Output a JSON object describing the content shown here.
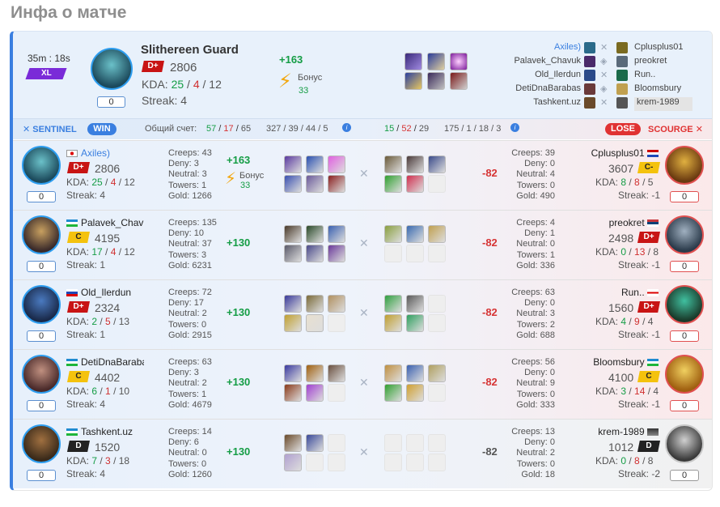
{
  "page_title": "Инфа о матче",
  "summary": {
    "duration": "35m : 18s",
    "mode": "XL",
    "player_name": "Slithereen Guard",
    "rank": "D+",
    "rating": "2806",
    "kda_label": "KDA:",
    "kills": "25",
    "deaths": "4",
    "assists": "12",
    "streak_text": "Streak: 4",
    "level": "0",
    "delta": "+163",
    "bonus_label": "Бонус",
    "bonus_value": "33"
  },
  "roster_left": [
    "Axiles)",
    "Palavek_Chavuk",
    "Old_Ilerdun",
    "DetiDnaBarabas",
    "Tashkent.uz"
  ],
  "roster_right": [
    "Cplusplus01",
    "preokret",
    "Run..",
    "Bloomsbury",
    "krem-1989"
  ],
  "scorebar": {
    "sentinel_label": "SENTINEL",
    "win_label": "WIN",
    "score_label": "Общий счет:",
    "left_kills": "57",
    "left_deaths": "17",
    "left_assists": "65",
    "left_creeps": "327 / 39 / 44 / 5",
    "right_kills": "15",
    "right_deaths": "52",
    "right_assists": "29",
    "right_creeps": "175 / 1 / 18 / 3",
    "lose_label": "LOSE",
    "scourge_label": "SCOURGE"
  },
  "rows": [
    {
      "left": {
        "name": "Axiles)",
        "rank": "D+",
        "rating": "2806",
        "k": "25",
        "d": "4",
        "a": "12",
        "streak": "Streak: 4",
        "level": "0",
        "creeps": "Creeps: 43",
        "deny": "Deny: 3",
        "neutral": "Neutral: 3",
        "towers": "Towers: 1",
        "gold": "Gold: 1266",
        "delta": "+163",
        "bonus_label": "Бонус",
        "bonus": "33"
      },
      "right": {
        "name": "Cplusplus01",
        "rank": "C-",
        "rating": "3607",
        "k": "8",
        "d": "8",
        "a": "5",
        "streak": "Streak: -1",
        "level": "0",
        "creeps": "Creeps: 39",
        "deny": "Deny: 0",
        "neutral": "Neutral: 4",
        "towers": "Towers: 0",
        "gold": "Gold: 490",
        "delta": "-82"
      }
    },
    {
      "left": {
        "name": "Palavek_Chavuk",
        "rank": "C",
        "rating": "4195",
        "k": "17",
        "d": "4",
        "a": "12",
        "streak": "Streak: 1",
        "level": "0",
        "creeps": "Creeps: 135",
        "deny": "Deny: 10",
        "neutral": "Neutral: 37",
        "towers": "Towers: 3",
        "gold": "Gold: 6231",
        "delta": "+130"
      },
      "right": {
        "name": "preokret",
        "rank": "D+",
        "rating": "2498",
        "k": "0",
        "d": "13",
        "a": "8",
        "streak": "Streak: -1",
        "level": "0",
        "creeps": "Creeps: 4",
        "deny": "Deny: 1",
        "neutral": "Neutral: 0",
        "towers": "Towers: 1",
        "gold": "Gold: 336",
        "delta": "-82"
      }
    },
    {
      "left": {
        "name": "Old_Ilerdun",
        "rank": "D+",
        "rating": "2324",
        "k": "2",
        "d": "5",
        "a": "13",
        "streak": "Streak: 1",
        "level": "0",
        "creeps": "Creeps: 72",
        "deny": "Deny: 17",
        "neutral": "Neutral: 2",
        "towers": "Towers: 0",
        "gold": "Gold: 2915",
        "delta": "+130"
      },
      "right": {
        "name": "Run..",
        "rank": "D+",
        "rating": "1560",
        "k": "4",
        "d": "9",
        "a": "4",
        "streak": "Streak: -1",
        "level": "0",
        "creeps": "Creeps: 63",
        "deny": "Deny: 0",
        "neutral": "Neutral: 3",
        "towers": "Towers: 2",
        "gold": "Gold: 688",
        "delta": "-82"
      }
    },
    {
      "left": {
        "name": "DetiDnaBarabas",
        "rank": "C",
        "rating": "4402",
        "k": "6",
        "d": "1",
        "a": "10",
        "streak": "Streak: 4",
        "level": "0",
        "creeps": "Creeps: 63",
        "deny": "Deny: 3",
        "neutral": "Neutral: 2",
        "towers": "Towers: 1",
        "gold": "Gold: 4679",
        "delta": "+130"
      },
      "right": {
        "name": "Bloomsbury",
        "rank": "C",
        "rating": "4100",
        "k": "3",
        "d": "14",
        "a": "4",
        "streak": "Streak: -1",
        "level": "0",
        "creeps": "Creeps: 56",
        "deny": "Deny: 0",
        "neutral": "Neutral: 9",
        "towers": "Towers: 0",
        "gold": "Gold: 333",
        "delta": "-82"
      }
    },
    {
      "left": {
        "name": "Tashkent.uz",
        "rank": "D",
        "rating": "1520",
        "k": "7",
        "d": "3",
        "a": "18",
        "streak": "Streak: 4",
        "level": "0",
        "creeps": "Creeps: 14",
        "deny": "Deny: 6",
        "neutral": "Neutral: 0",
        "towers": "Towers: 0",
        "gold": "Gold: 1260",
        "delta": "+130"
      },
      "right": {
        "name": "krem-1989",
        "rank": "D",
        "rating": "1012",
        "k": "0",
        "d": "8",
        "a": "8",
        "streak": "Streak: -2",
        "level": "0",
        "creeps": "Creeps: 13",
        "deny": "Deny: 0",
        "neutral": "Neutral: 2",
        "towers": "Towers: 0",
        "gold": "Gold: 18",
        "delta": "-82"
      }
    }
  ],
  "colors": {
    "sentinel": "#3a7fe0",
    "win": "#3a7fe0",
    "lose": "#e03232",
    "kills": "#159d45",
    "deaths": "#d03030"
  }
}
